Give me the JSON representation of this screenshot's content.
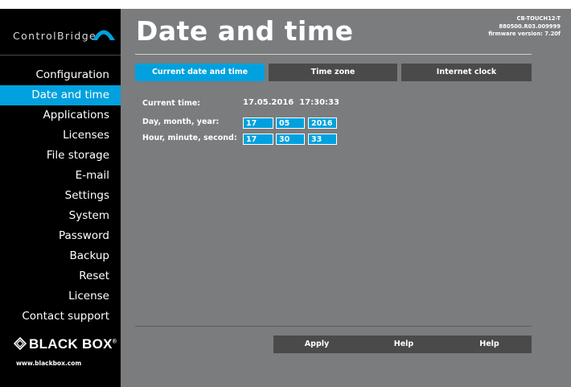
{
  "sidebar": {
    "logo_text": "ControlBridge",
    "nav": [
      {
        "label": "Configuration",
        "active": false
      },
      {
        "label": "Date and time",
        "active": true
      },
      {
        "label": "Applications",
        "active": false
      },
      {
        "label": "Licenses",
        "active": false
      },
      {
        "label": "File storage",
        "active": false
      },
      {
        "label": "E-mail",
        "active": false
      },
      {
        "label": "Settings",
        "active": false
      },
      {
        "label": "System",
        "active": false
      },
      {
        "label": "Password",
        "active": false
      },
      {
        "label": "Backup",
        "active": false
      },
      {
        "label": "Reset",
        "active": false
      },
      {
        "label": "License",
        "active": false
      },
      {
        "label": "Contact support",
        "active": false
      }
    ],
    "brand": "BLACK BOX",
    "brand_mark": "®",
    "brand_url": "www.blackbox.com"
  },
  "header": {
    "title": "Date and time",
    "device_model": "CB-TOUCH12-T",
    "serial": "880500.R03.009999",
    "firmware": "firmware version: 7.20f"
  },
  "tabs": [
    {
      "label": "Current date and time",
      "active": true
    },
    {
      "label": "Time zone",
      "active": false
    },
    {
      "label": "Internet clock",
      "active": false
    }
  ],
  "form": {
    "current_time_label": "Current time:",
    "current_time_value": "17.05.2016  17:30:33",
    "date_label": "Day, month, year:",
    "day": "17",
    "month": "05",
    "year": "2016",
    "time_label": "Hour, minute, second:",
    "hour": "17",
    "minute": "30",
    "second": "33"
  },
  "buttons": {
    "apply": "Apply",
    "help1": "Help",
    "help2": "Help"
  },
  "colors": {
    "accent": "#00a1de",
    "sidebar_bg": "#000000",
    "main_bg": "#7a7c7e",
    "button_bg": "#4a4a4a"
  }
}
